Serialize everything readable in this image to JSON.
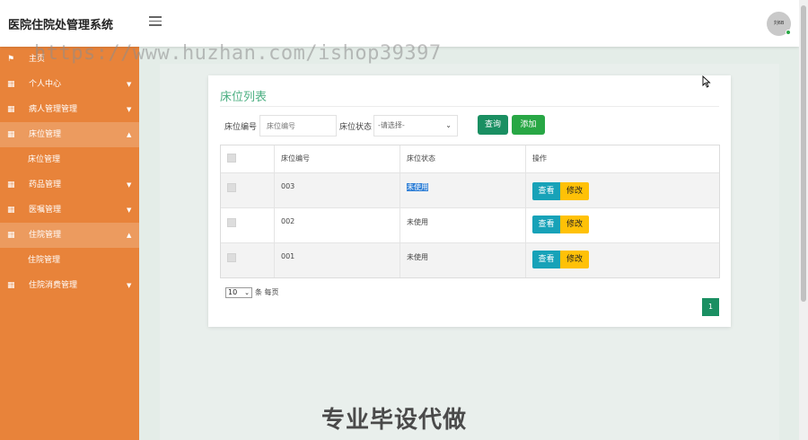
{
  "app": {
    "title": "医院住院处管理系统",
    "avatar_text": "刘6B"
  },
  "watermark": "https://www.huzhan.com/ishop39397",
  "sidebar": {
    "items": [
      {
        "label": "主页",
        "icon": "flag-icon",
        "caret": "",
        "active": false,
        "sub": false
      },
      {
        "label": "个人中心",
        "icon": "grid-icon",
        "caret": "▼",
        "active": false,
        "sub": false
      },
      {
        "label": "病人管理管理",
        "icon": "grid-icon",
        "caret": "▼",
        "active": false,
        "sub": false
      },
      {
        "label": "床位管理",
        "icon": "grid-icon",
        "caret": "▲",
        "active": true,
        "sub": false
      },
      {
        "label": "床位管理",
        "icon": "",
        "caret": "",
        "active": false,
        "sub": true
      },
      {
        "label": "药品管理",
        "icon": "grid-icon",
        "caret": "▼",
        "active": false,
        "sub": false
      },
      {
        "label": "医嘱管理",
        "icon": "grid-icon",
        "caret": "▼",
        "active": false,
        "sub": false
      },
      {
        "label": "住院管理",
        "icon": "grid-icon",
        "caret": "▲",
        "active": true,
        "sub": false
      },
      {
        "label": "住院管理",
        "icon": "",
        "caret": "",
        "active": false,
        "sub": true
      },
      {
        "label": "住院消费管理",
        "icon": "grid-icon",
        "caret": "▼",
        "active": false,
        "sub": false
      }
    ]
  },
  "card": {
    "title": "床位列表",
    "filters": {
      "bed_no_label": "床位编号",
      "bed_no_placeholder": "床位编号",
      "status_label": "床位状态",
      "status_value": "-请选择-",
      "query_label": "查询",
      "add_label": "添加"
    },
    "table": {
      "headers": [
        "床位编号",
        "床位状态",
        "操作"
      ],
      "rows": [
        {
          "bed_no": "003",
          "status": "未使用"
        },
        {
          "bed_no": "002",
          "status": "未使用"
        },
        {
          "bed_no": "001",
          "status": "未使用"
        }
      ],
      "view_label": "查看",
      "edit_label": "修改"
    },
    "pager": {
      "page_size": "10",
      "per_page_label": "条 每页",
      "current_page": "1"
    }
  },
  "footer_text": "专业毕设代做",
  "colors": {
    "sidebar": "#e8833a",
    "title": "#4caf82",
    "primary": "#1a8f62",
    "view": "#17a2b8",
    "edit": "#ffc107"
  }
}
